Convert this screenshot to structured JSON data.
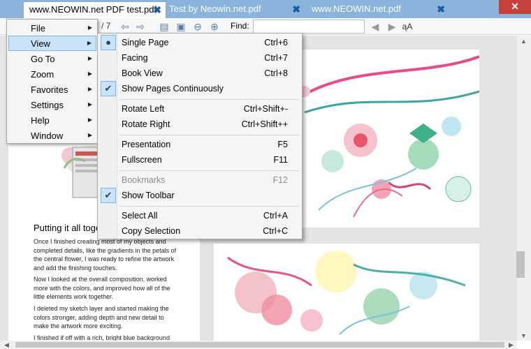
{
  "tabs": [
    {
      "title": "www.NEOWIN.net PDF test.pdf"
    },
    {
      "title": "Test by Neowin.net.pdf"
    },
    {
      "title": "www.NEOWIN.net.pdf"
    }
  ],
  "tab_close_glyph": "✖",
  "window_close_glyph": "✕",
  "toolbar": {
    "page_total": "/ 7",
    "find_label": "Find:",
    "find_value": "",
    "icons": [
      "back-arrow-icon",
      "forward-arrow-icon",
      "fit-width-icon",
      "fit-page-icon",
      "zoom-out-icon",
      "zoom-in-icon",
      "find-previous-icon",
      "find-next-icon",
      "match-case-icon"
    ]
  },
  "main_menu": {
    "items": [
      {
        "label": "File"
      },
      {
        "label": "View"
      },
      {
        "label": "Go To"
      },
      {
        "label": "Zoom"
      },
      {
        "label": "Favorites"
      },
      {
        "label": "Settings"
      },
      {
        "label": "Help"
      },
      {
        "label": "Window"
      }
    ],
    "highlighted": "View"
  },
  "view_menu": {
    "items": [
      {
        "label": "Single Page",
        "shortcut": "Ctrl+6",
        "mark": "radio"
      },
      {
        "label": "Facing",
        "shortcut": "Ctrl+7"
      },
      {
        "label": "Book View",
        "shortcut": "Ctrl+8"
      },
      {
        "label": "Show Pages Continuously",
        "shortcut": "",
        "mark": "check"
      },
      {
        "label": "Rotate Left",
        "shortcut": "Ctrl+Shift+-"
      },
      {
        "label": "Rotate Right",
        "shortcut": "Ctrl+Shift++"
      },
      {
        "label": "Presentation",
        "shortcut": "F5"
      },
      {
        "label": "Fullscreen",
        "shortcut": "F11"
      },
      {
        "label": "Bookmarks",
        "shortcut": "F12",
        "disabled": true
      },
      {
        "label": "Show Toolbar",
        "shortcut": "",
        "mark": "check"
      },
      {
        "label": "Select All",
        "shortcut": "Ctrl+A"
      },
      {
        "label": "Copy Selection",
        "shortcut": "Ctrl+C"
      }
    ]
  },
  "document": {
    "heading": "Putting it all toget",
    "paragraphs": [
      "Once I finished creating most of my objects and completed details, like the gradients in the petals of the central flower, I was ready to refine the artwork and add the finishing touches.",
      "Now I looked at the overall composition, worked more with the colors, and improved how all of the little elements work together.",
      "I deleted my sketch layer and started making the colors stronger, adding depth and new detail to make the artwork more exciting.",
      "I finished if off with a rich, bright blue background"
    ]
  },
  "colors": {
    "titlebar": "#8ab4dc",
    "close_button": "#c7403a",
    "menu_highlight": "#cbe3f8",
    "menu_highlight_border": "#7eb4ea"
  }
}
